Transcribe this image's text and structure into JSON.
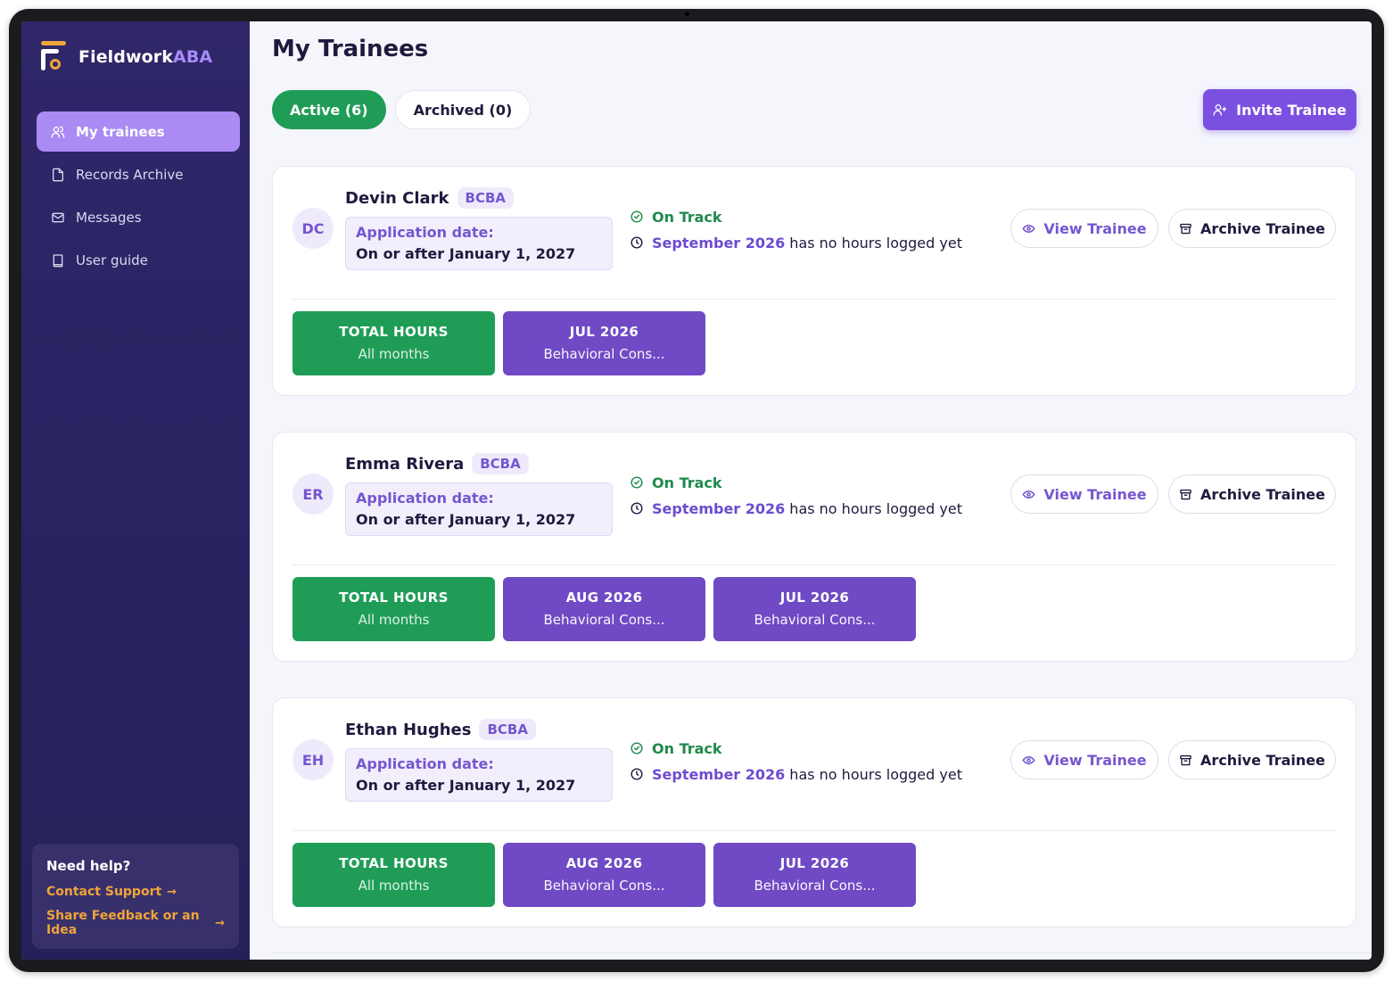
{
  "app": {
    "brand_main": "Fieldwork",
    "brand_accent": "ABA",
    "colors": {
      "sidebar": "#2a2463",
      "active_nav": "#a98bf3",
      "green": "#1f9d57",
      "purple": "#6f4ac4",
      "accent": "#7b4fe0"
    }
  },
  "sidebar": {
    "items": [
      {
        "label": "My trainees",
        "icon": "users-icon"
      },
      {
        "label": "Records Archive",
        "icon": "document-icon"
      },
      {
        "label": "Messages",
        "icon": "mail-icon"
      },
      {
        "label": "User guide",
        "icon": "book-icon"
      }
    ],
    "help": {
      "title": "Need help?",
      "contact": "Contact Support",
      "feedback": "Share Feedback or an Idea"
    }
  },
  "main": {
    "title": "My Trainees",
    "tabs": [
      {
        "label": "Active (6)"
      },
      {
        "label": "Archived (0)"
      }
    ],
    "invite_label": "Invite Trainee",
    "view_label": "View Trainee",
    "archive_label": "Archive Trainee",
    "trainees": [
      {
        "initials": "DC",
        "name": "Devin Clark",
        "badge": "BCBA",
        "app_label": "Application date:",
        "app_value": "On or after January 1, 2027",
        "status": "On Track",
        "pending_month": "September 2026",
        "pending_text": "has no hours logged yet",
        "chips": [
          {
            "top": "TOTAL HOURS",
            "bottom": "All months"
          },
          {
            "top": "JUL 2026",
            "bottom": "Behavioral Cons..."
          }
        ]
      },
      {
        "initials": "ER",
        "name": "Emma Rivera",
        "badge": "BCBA",
        "app_label": "Application date:",
        "app_value": "On or after January 1, 2027",
        "status": "On Track",
        "pending_month": "September 2026",
        "pending_text": "has no hours logged yet",
        "chips": [
          {
            "top": "TOTAL HOURS",
            "bottom": "All months"
          },
          {
            "top": "AUG 2026",
            "bottom": "Behavioral Cons..."
          },
          {
            "top": "JUL 2026",
            "bottom": "Behavioral Cons..."
          }
        ]
      },
      {
        "initials": "EH",
        "name": "Ethan Hughes",
        "badge": "BCBA",
        "app_label": "Application date:",
        "app_value": "On or after January 1, 2027",
        "status": "On Track",
        "pending_month": "September 2026",
        "pending_text": "has no hours logged yet",
        "chips": [
          {
            "top": "TOTAL HOURS",
            "bottom": "All months"
          },
          {
            "top": "AUG 2026",
            "bottom": "Behavioral Cons..."
          },
          {
            "top": "JUL 2026",
            "bottom": "Behavioral Cons..."
          }
        ]
      }
    ]
  }
}
